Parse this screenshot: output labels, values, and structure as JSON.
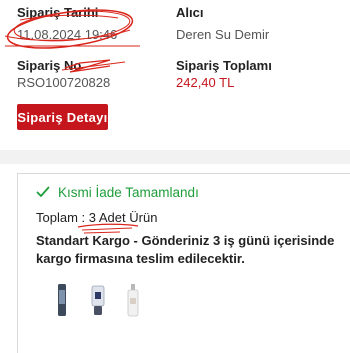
{
  "order": {
    "date_label": "Sipariş Tarihi",
    "date_value": "11.08.2024 19:46",
    "recipient_label": "Alıcı",
    "recipient_value": "Deren Su Demir",
    "number_label": "Sipariş No",
    "number_value": "RSO100720828",
    "total_label": "Sipariş Toplamı",
    "total_value": "242,40 TL"
  },
  "actions": {
    "detail_button": "Sipariş Detayı"
  },
  "shipment": {
    "status_text": "Kısmi İade Tamamlandı",
    "total_prefix": "Toplam :",
    "total_count": "3 Adet Ürün",
    "cargo_text": "Standart Kargo - Gönderiniz 3 iş günü içerisinde kargo firmasına teslim edilecektir."
  },
  "products": [
    {
      "icon": "product-thumbnail-1"
    },
    {
      "icon": "product-thumbnail-2"
    },
    {
      "icon": "product-thumbnail-3"
    }
  ],
  "colors": {
    "brand_red": "#c4161c",
    "success_green": "#1f9d3a",
    "annotation_red": "#d9261c"
  }
}
